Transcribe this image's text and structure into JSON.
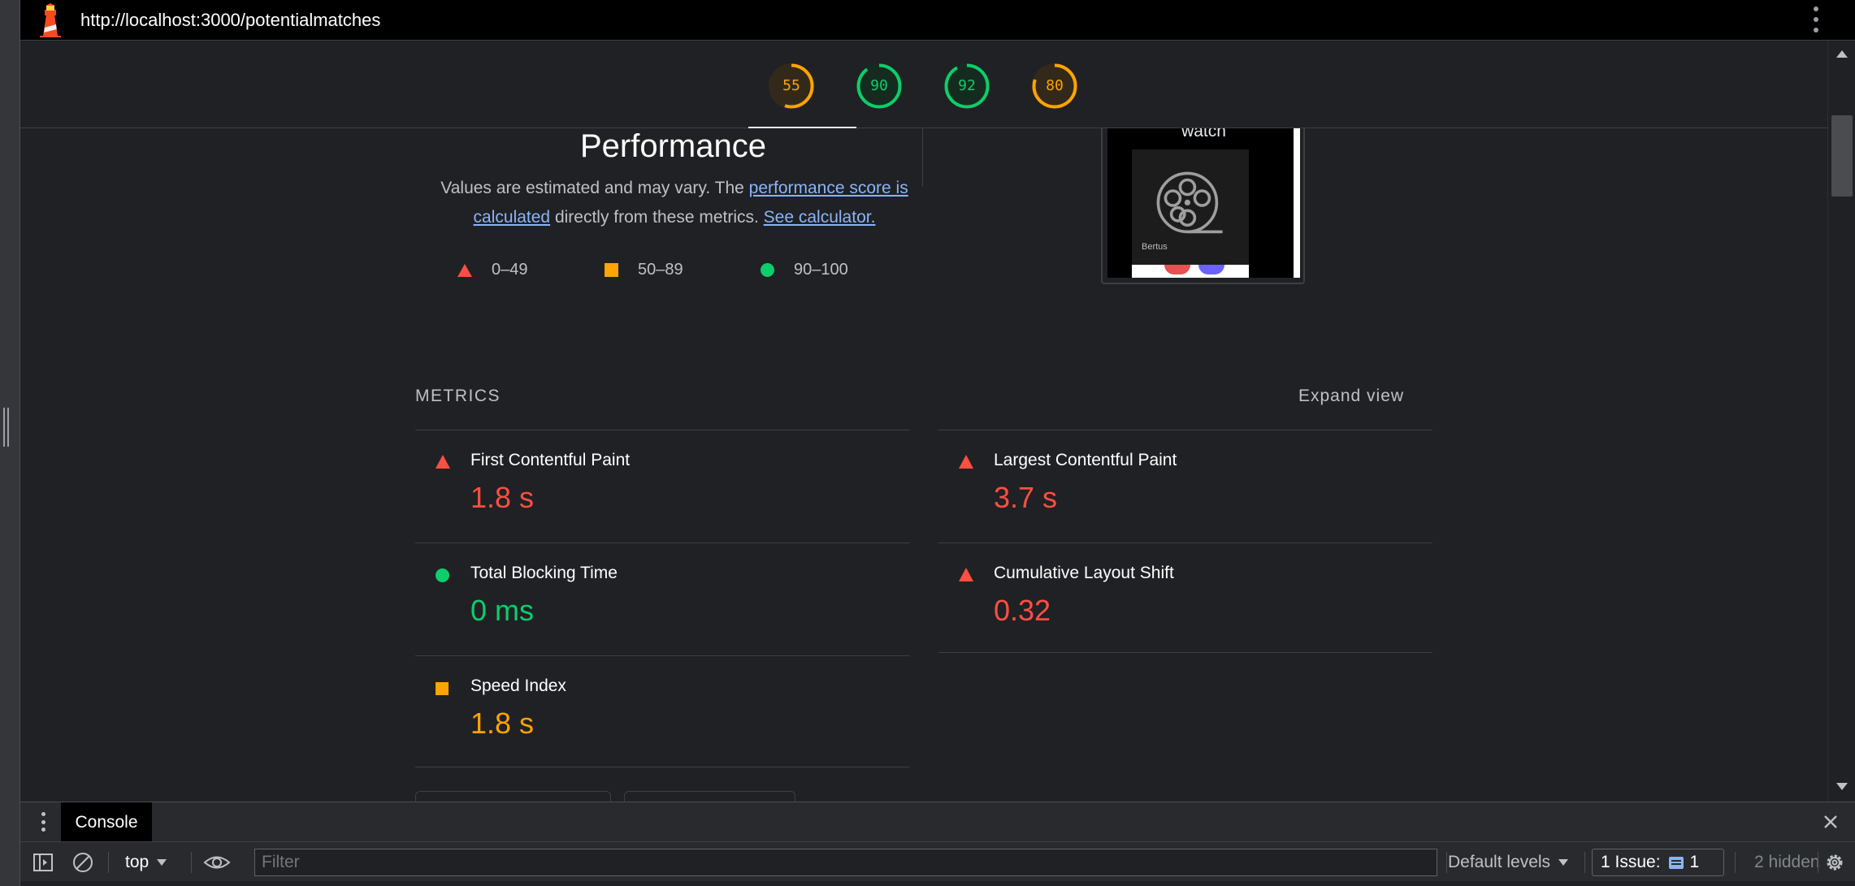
{
  "url_bar": {
    "url": "http://localhost:3000/potentialmatches",
    "logo_icon": "lighthouse-icon",
    "menu_icon": "kebab-menu-icon"
  },
  "scores": [
    {
      "value": "55",
      "status": "average",
      "color": "#ffa400",
      "fraction": 0.55
    },
    {
      "value": "90",
      "status": "pass",
      "color": "#0cce6b",
      "fraction": 0.9
    },
    {
      "value": "92",
      "status": "pass",
      "color": "#0cce6b",
      "fraction": 0.92
    },
    {
      "value": "80",
      "status": "average",
      "color": "#ffa400",
      "fraction": 0.8
    }
  ],
  "performance": {
    "title": "Performance",
    "desc_prefix": "Values are estimated and may vary. The ",
    "score_link": "performance score is calculated",
    "desc_middle": " directly from these metrics. ",
    "calc_link": "See calculator."
  },
  "legend": [
    {
      "range": "0–49",
      "shape": "triangle",
      "color": "#ff4e42"
    },
    {
      "range": "50–89",
      "shape": "square",
      "color": "#ffa400"
    },
    {
      "range": "90–100",
      "shape": "circle",
      "color": "#0cce6b"
    }
  ],
  "screenshot": {
    "heading": "watch",
    "card_name": "Bertus",
    "card_icon": "film-reel-icon"
  },
  "metrics": {
    "label": "METRICS",
    "expand_label": "Expand view",
    "items": [
      {
        "name": "First Contentful Paint",
        "value": "1.8 s",
        "status": "fail"
      },
      {
        "name": "Largest Contentful Paint",
        "value": "3.7 s",
        "status": "fail"
      },
      {
        "name": "Total Blocking Time",
        "value": "0 ms",
        "status": "pass"
      },
      {
        "name": "Cumulative Layout Shift",
        "value": "0.32",
        "status": "fail"
      },
      {
        "name": "Speed Index",
        "value": "1.8 s",
        "status": "average"
      }
    ]
  },
  "drawer": {
    "tab_label": "Console",
    "context": "top",
    "filter_placeholder": "Filter",
    "levels": "Default levels",
    "issue_label": "1 Issue:",
    "issue_count": "1",
    "hidden": "2 hidden"
  },
  "colors": {
    "fail": "#ff4e42",
    "average": "#ffa400",
    "pass": "#0cce6b",
    "link": "#8ab4f8",
    "background": "#202124"
  }
}
